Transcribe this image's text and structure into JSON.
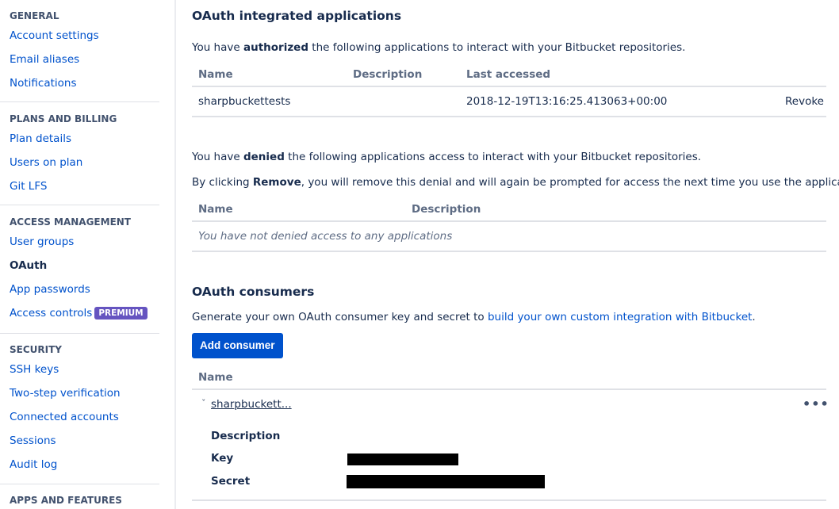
{
  "sidebar": {
    "groups": [
      {
        "heading": "GENERAL",
        "items": [
          "Account settings",
          "Email aliases",
          "Notifications"
        ]
      },
      {
        "heading": "PLANS AND BILLING",
        "items": [
          "Plan details",
          "Users on plan",
          "Git LFS"
        ]
      },
      {
        "heading": "ACCESS MANAGEMENT",
        "items": [
          "User groups",
          "OAuth",
          "App passwords",
          "Access controls"
        ]
      },
      {
        "heading": "SECURITY",
        "items": [
          "SSH keys",
          "Two-step verification",
          "Connected accounts",
          "Sessions",
          "Audit log"
        ]
      },
      {
        "heading": "APPS AND FEATURES",
        "items": []
      }
    ],
    "active_item": "OAuth",
    "premium_badge": "PREMIUM"
  },
  "authorized": {
    "title": "OAuth integrated applications",
    "intro_prefix": "You have ",
    "intro_bold": "authorized",
    "intro_suffix": " the following applications to interact with your Bitbucket repositories.",
    "columns": [
      "Name",
      "Description",
      "Last accessed"
    ],
    "rows": [
      {
        "name": "sharpbuckettests",
        "description": "",
        "last_accessed": "2018-12-19T13:16:25.413063+00:00",
        "action": "Revoke"
      }
    ]
  },
  "denied": {
    "intro_prefix": "You have ",
    "intro_bold": "denied",
    "intro_suffix": " the following applications access to interact with your Bitbucket repositories.",
    "remove_prefix": "By clicking ",
    "remove_bold": "Remove",
    "remove_suffix": ", you will remove this denial and will again be prompted for access the next time you use the application.",
    "columns": [
      "Name",
      "Description"
    ],
    "empty_message": "You have not denied access to any applications"
  },
  "consumers": {
    "title": "OAuth consumers",
    "intro_prefix": "Generate your own OAuth consumer key and secret to ",
    "intro_link": "build your own custom integration with Bitbucket",
    "intro_suffix": ".",
    "add_button": "Add consumer",
    "column_name": "Name",
    "items": [
      {
        "name": "sharpbuckett...",
        "labels": {
          "description": "Description",
          "key": "Key",
          "secret": "Secret"
        }
      }
    ],
    "more_icon": "more-horizontal-icon",
    "chevron_icon": "chevron-down-icon",
    "chevron_glyph": "ˇ",
    "more_glyph": "•••"
  },
  "colors": {
    "link": "#0052cc",
    "button": "#0052cc",
    "premium": "#6554c0",
    "text": "#172b4d",
    "muted": "#5e6c84"
  }
}
